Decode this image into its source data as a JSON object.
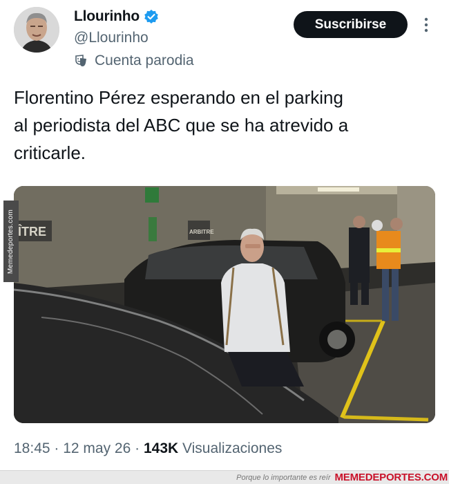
{
  "author": {
    "display_name": "Llourinho",
    "handle": "@Llourinho",
    "parody_label": "Cuenta parodia",
    "verified_color": "#1d9bf0"
  },
  "actions": {
    "subscribe_label": "Suscribirse",
    "more_icon": "more-vertical-icon"
  },
  "tweet": {
    "text": "Florentino Pérez esperando en el parking\nal periodista del ABC que se ha atrevido a\ncriticarle.",
    "time": "18:45",
    "date": "12 may 26",
    "views_count": "143K",
    "views_label": "Visualizaciones"
  },
  "media": {
    "sign_left": "ÎTRE",
    "sign_right": "ARBITRE"
  },
  "watermark": {
    "side_text": "Memedeportes.com",
    "footer_tagline": "Porque lo importante es reír",
    "footer_brand": "MEMEDEPORTES.COM"
  }
}
